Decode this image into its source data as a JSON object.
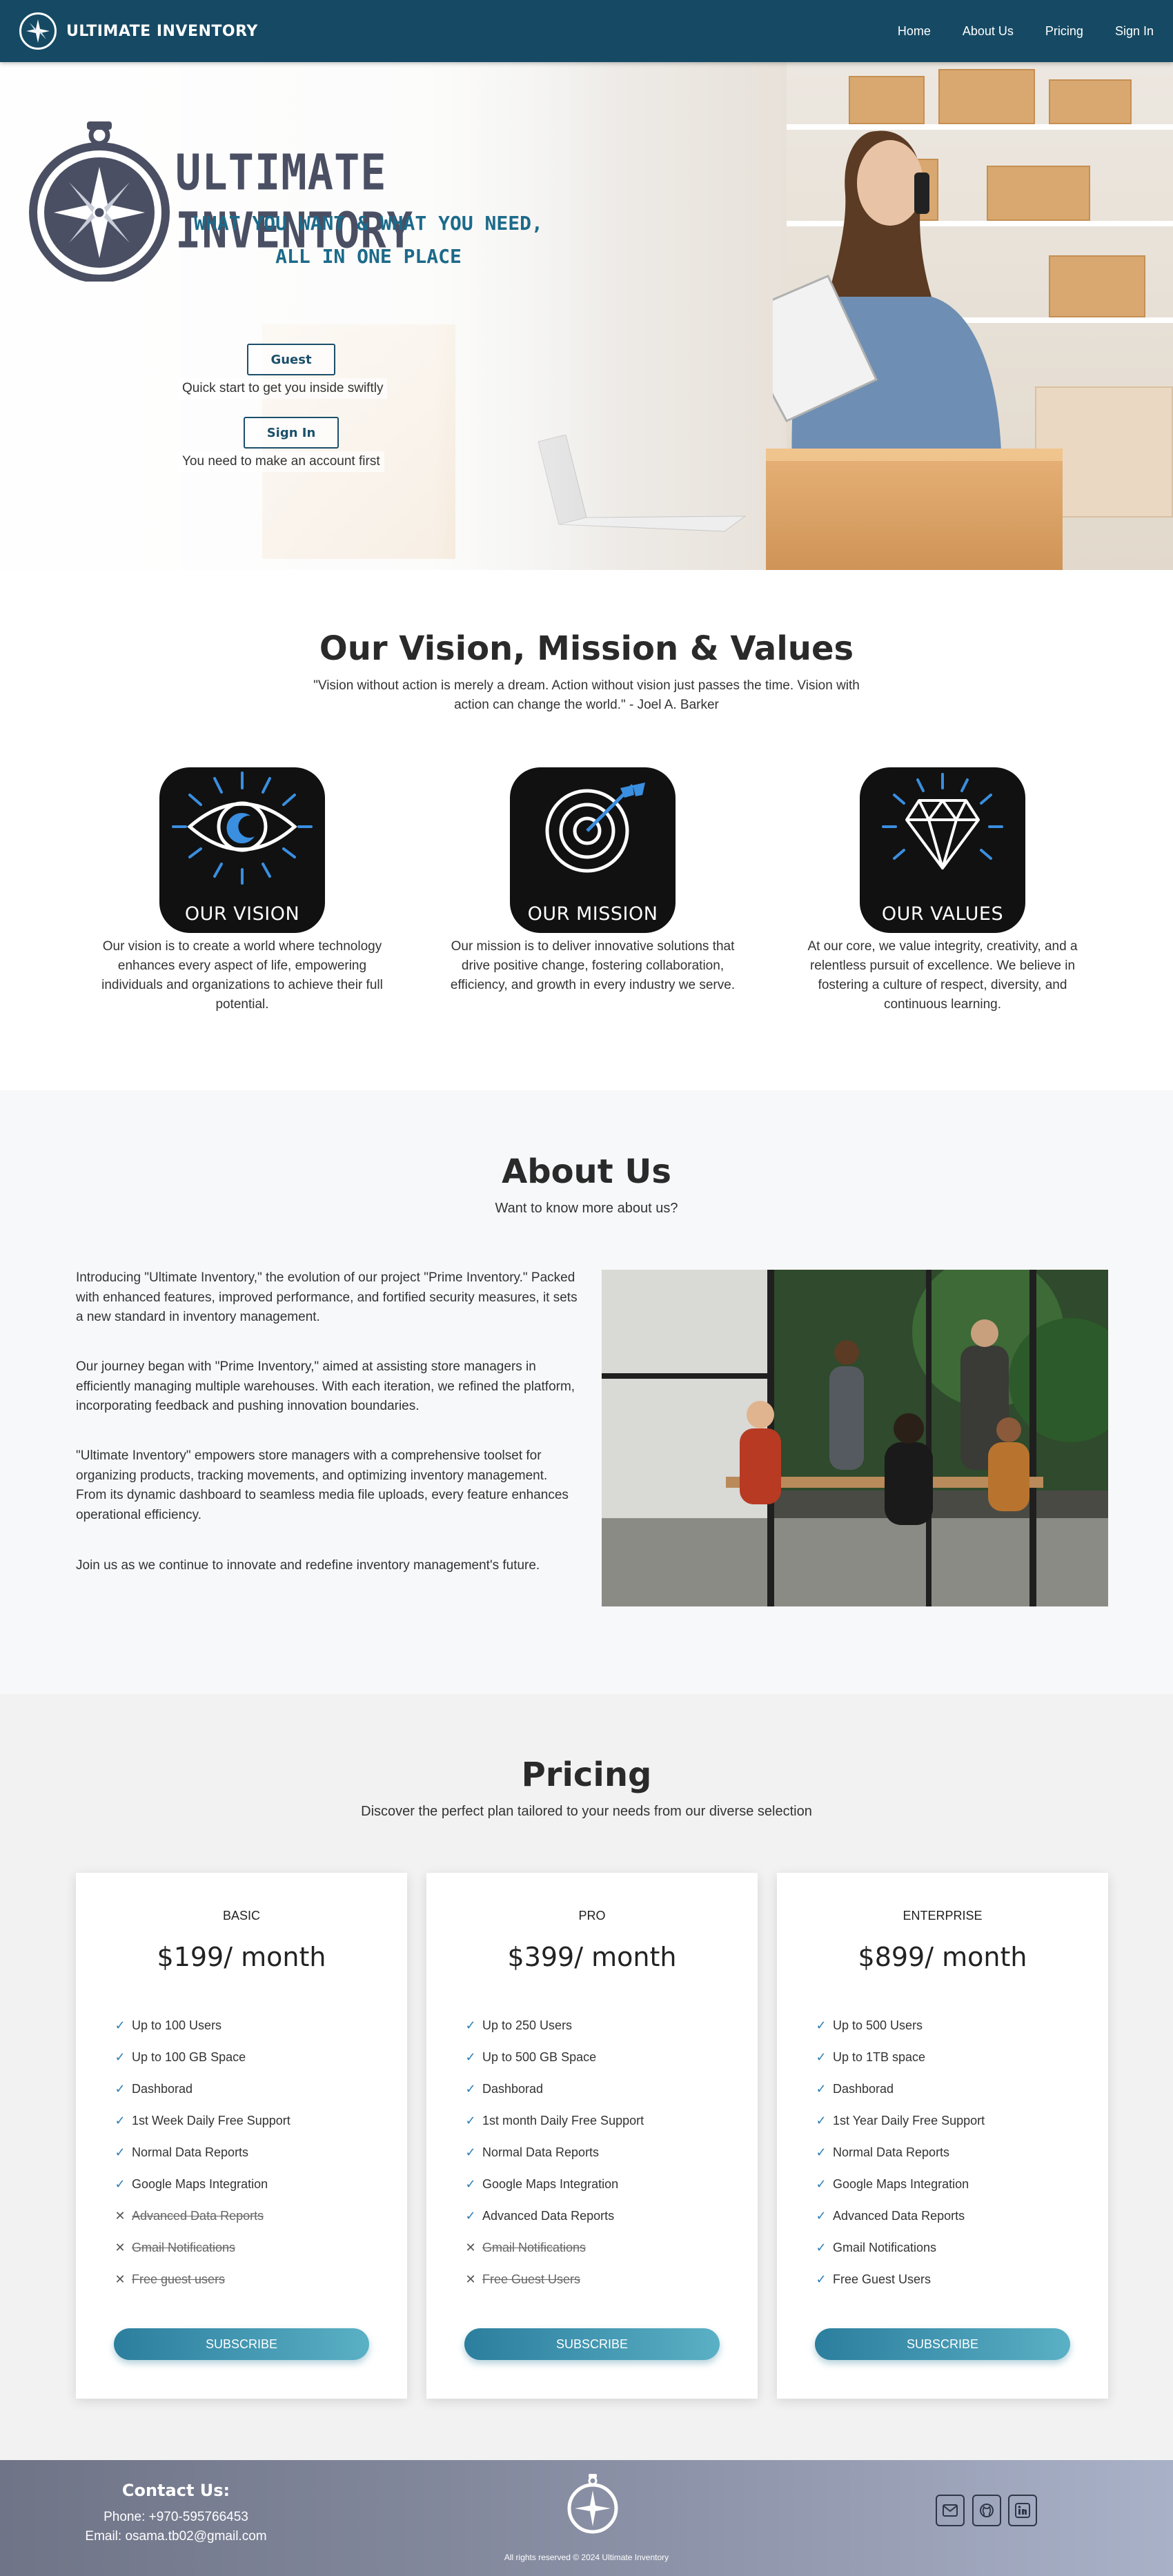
{
  "nav": {
    "brand": "ULTIMATE INVENTORY",
    "links": [
      "Home",
      "About Us",
      "Pricing",
      "Sign In"
    ]
  },
  "hero": {
    "title": "ULTIMATE INVENTORY",
    "tagline_line1": "WHAT YOU WANT & WHAT YOU NEED,",
    "tagline_line2": "ALL IN ONE PLACE",
    "guest_button": "Guest",
    "guest_note": "Quick start to get you inside swiftly",
    "signin_button": "Sign In",
    "signin_note": "You need to make an account first"
  },
  "vision": {
    "title": "Our Vision, Mission & Values",
    "quote": "\"Vision without action is merely a dream. Action without vision just passes the time. Vision with action can change the world.\" - Joel A. Barker",
    "cards": [
      {
        "label": "OUR VISION",
        "icon": "eye-icon",
        "text": "Our vision is to create a world where technology enhances every aspect of life, empowering individuals and organizations to achieve their full potential."
      },
      {
        "label": "OUR MISSION",
        "icon": "target-icon",
        "text": "Our mission is to deliver innovative solutions that drive positive change, fostering collaboration, efficiency, and growth in every industry we serve."
      },
      {
        "label": "OUR VALUES",
        "icon": "diamond-icon",
        "text": "At our core, we value integrity, creativity, and a relentless pursuit of excellence. We believe in fostering a culture of respect, diversity, and continuous learning."
      }
    ]
  },
  "about": {
    "title": "About Us",
    "subtitle": "Want to know more about us?",
    "paragraphs": [
      "Introducing \"Ultimate Inventory,\" the evolution of our project \"Prime Inventory.\" Packed with enhanced features, improved performance, and fortified security measures, it sets a new standard in inventory management.",
      "Our journey began with \"Prime Inventory,\" aimed at assisting store managers in efficiently managing multiple warehouses. With each iteration, we refined the platform, incorporating feedback and pushing innovation boundaries.",
      "\"Ultimate Inventory\" empowers store managers with a comprehensive toolset for organizing products, tracking movements, and optimizing inventory management. From its dynamic dashboard to seamless media file uploads, every feature enhances operational efficiency.",
      "Join us as we continue to innovate and redefine inventory management's future."
    ]
  },
  "pricing": {
    "title": "Pricing",
    "subtitle": "Discover the perfect plan tailored to your needs from our diverse selection",
    "plans": [
      {
        "name": "BASIC",
        "price": "$199/ month",
        "button": "SUBSCRIBE",
        "features": [
          {
            "text": "Up to 100 Users",
            "included": true
          },
          {
            "text": "Up to 100 GB Space",
            "included": true
          },
          {
            "text": "Dashborad",
            "included": true
          },
          {
            "text": "1st Week Daily Free Support",
            "included": true
          },
          {
            "text": "Normal Data Reports",
            "included": true
          },
          {
            "text": "Google Maps Integration",
            "included": true
          },
          {
            "text": "Advanced Data Reports",
            "included": false
          },
          {
            "text": "Gmail Notifications",
            "included": false
          },
          {
            "text": "Free guest users",
            "included": false
          }
        ]
      },
      {
        "name": "PRO",
        "price": "$399/ month",
        "button": "SUBSCRIBE",
        "features": [
          {
            "text": "Up to 250 Users",
            "included": true
          },
          {
            "text": "Up to 500 GB Space",
            "included": true
          },
          {
            "text": "Dashborad",
            "included": true
          },
          {
            "text": "1st month Daily Free Support",
            "included": true
          },
          {
            "text": "Normal Data Reports",
            "included": true
          },
          {
            "text": "Google Maps Integration",
            "included": true
          },
          {
            "text": "Advanced Data Reports",
            "included": true
          },
          {
            "text": "Gmail Notifications",
            "included": false
          },
          {
            "text": "Free Guest Users",
            "included": false
          }
        ]
      },
      {
        "name": "ENTERPRISE",
        "price": "$899/ month",
        "button": "SUBSCRIBE",
        "features": [
          {
            "text": "Up to 500 Users",
            "included": true
          },
          {
            "text": "Up to 1TB space",
            "included": true
          },
          {
            "text": "Dashborad",
            "included": true
          },
          {
            "text": "1st Year Daily Free Support",
            "included": true
          },
          {
            "text": "Normal Data Reports",
            "included": true
          },
          {
            "text": "Google Maps Integration",
            "included": true
          },
          {
            "text": "Advanced Data Reports",
            "included": true
          },
          {
            "text": "Gmail Notifications",
            "included": true
          },
          {
            "text": "Free Guest Users",
            "included": true
          }
        ]
      }
    ]
  },
  "footer": {
    "contact_title": "Contact Us:",
    "phone": "Phone: +970-595766453",
    "email": "Email: osama.tb02@gmail.com",
    "copyright": "All rights reserved © 2024 Ultimate Inventory",
    "social": [
      "mail-icon",
      "github-icon",
      "linkedin-icon"
    ]
  },
  "colors": {
    "nav": "#164a64",
    "accent": "#2d7fb8",
    "icon_blue": "#3a8fe0",
    "card_bg": "#111111"
  }
}
